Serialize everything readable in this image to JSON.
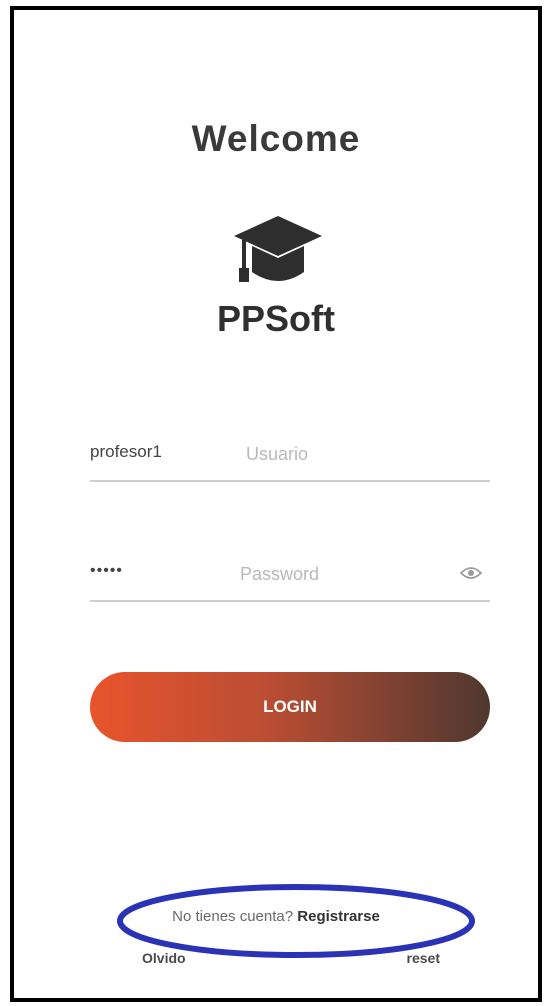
{
  "welcome_title": "Welcome",
  "brand": {
    "name": "PPSoft",
    "icon": "graduation-cap-icon"
  },
  "username_field": {
    "value": "profesor1",
    "placeholder": "Usuario"
  },
  "password_field": {
    "value": "•••••",
    "placeholder": "Password",
    "toggle_icon": "eye-icon"
  },
  "login_button": {
    "label": "LOGIN"
  },
  "register": {
    "prompt": "No tienes cuenta?",
    "link_label": "Registrarse"
  },
  "partial_row": {
    "left_text": "Olvido",
    "right_text": "reset"
  },
  "colors": {
    "button_gradient_start": "#e8542c",
    "button_gradient_end": "#4f3830",
    "highlight_ellipse": "#2a33b5"
  }
}
